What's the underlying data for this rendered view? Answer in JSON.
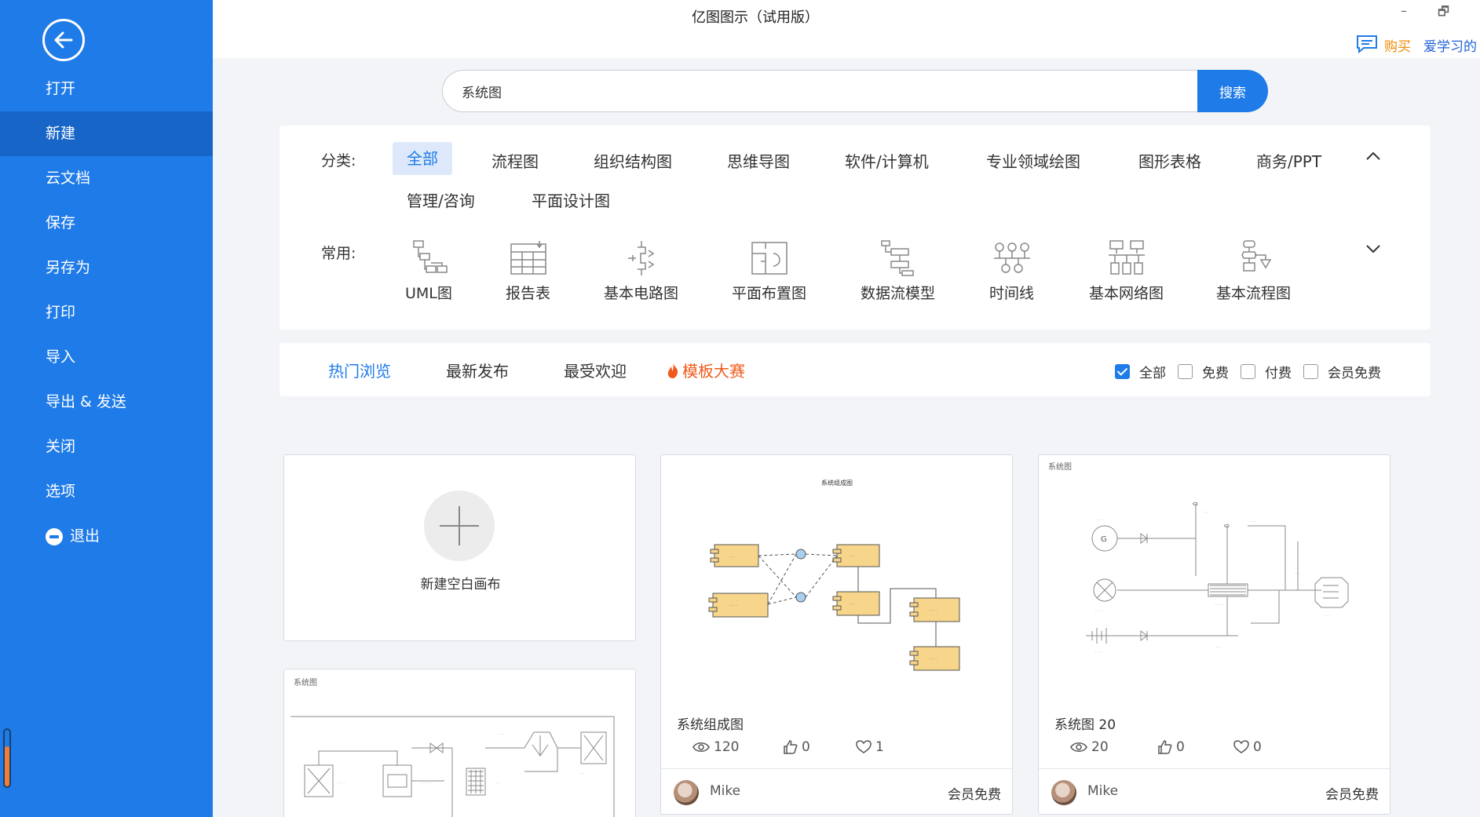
{
  "app": {
    "title": "亿图图示（试用版）",
    "minimize": "–",
    "restore": "🗗",
    "buy": "购买",
    "learn": "爱学习的"
  },
  "sidebar": {
    "items": [
      {
        "label": "打开"
      },
      {
        "label": "新建"
      },
      {
        "label": "云文档"
      },
      {
        "label": "保存"
      },
      {
        "label": "另存为"
      },
      {
        "label": "打印"
      },
      {
        "label": "导入"
      },
      {
        "label": "导出 & 发送"
      },
      {
        "label": "关闭"
      },
      {
        "label": "选项"
      },
      {
        "label": "退出"
      }
    ],
    "active": "新建"
  },
  "search": {
    "value": "系统图",
    "button": "搜索"
  },
  "categories": {
    "label": "分类:",
    "items": [
      "全部",
      "流程图",
      "组织结构图",
      "思维导图",
      "软件/计算机",
      "专业领域绘图",
      "图形表格",
      "商务/PPT",
      "管理/咨询",
      "平面设计图"
    ],
    "active": "全部"
  },
  "common": {
    "label": "常用:",
    "items": [
      "UML图",
      "报告表",
      "基本电路图",
      "平面布置图",
      "数据流模型",
      "时间线",
      "基本网络图",
      "基本流程图"
    ]
  },
  "tabs": {
    "items": [
      "热门浏览",
      "最新发布",
      "最受欢迎",
      "模板大赛"
    ],
    "active": "热门浏览"
  },
  "filters": [
    {
      "label": "全部",
      "checked": true
    },
    {
      "label": "免费",
      "checked": false
    },
    {
      "label": "付费",
      "checked": false
    },
    {
      "label": "会员免费",
      "checked": false
    }
  ],
  "new_canvas": {
    "label": "新建空白画布"
  },
  "cards": [
    {
      "title": "系统组成图",
      "views": "120",
      "likes": "0",
      "favorites": "1",
      "author": "Mike",
      "price": "会员免费",
      "thumb_title": "系统组成图"
    },
    {
      "title": "系统图 20",
      "views": "20",
      "likes": "0",
      "favorites": "0",
      "author": "Mike",
      "price": "会员免费",
      "thumb_title": "系统图"
    },
    {
      "thumb_title": "系统图"
    }
  ],
  "colors": {
    "accent": "#1f7be8",
    "sidebar": "#1f7be8",
    "contest": "#f05a1a",
    "buy": "#f08a00"
  }
}
